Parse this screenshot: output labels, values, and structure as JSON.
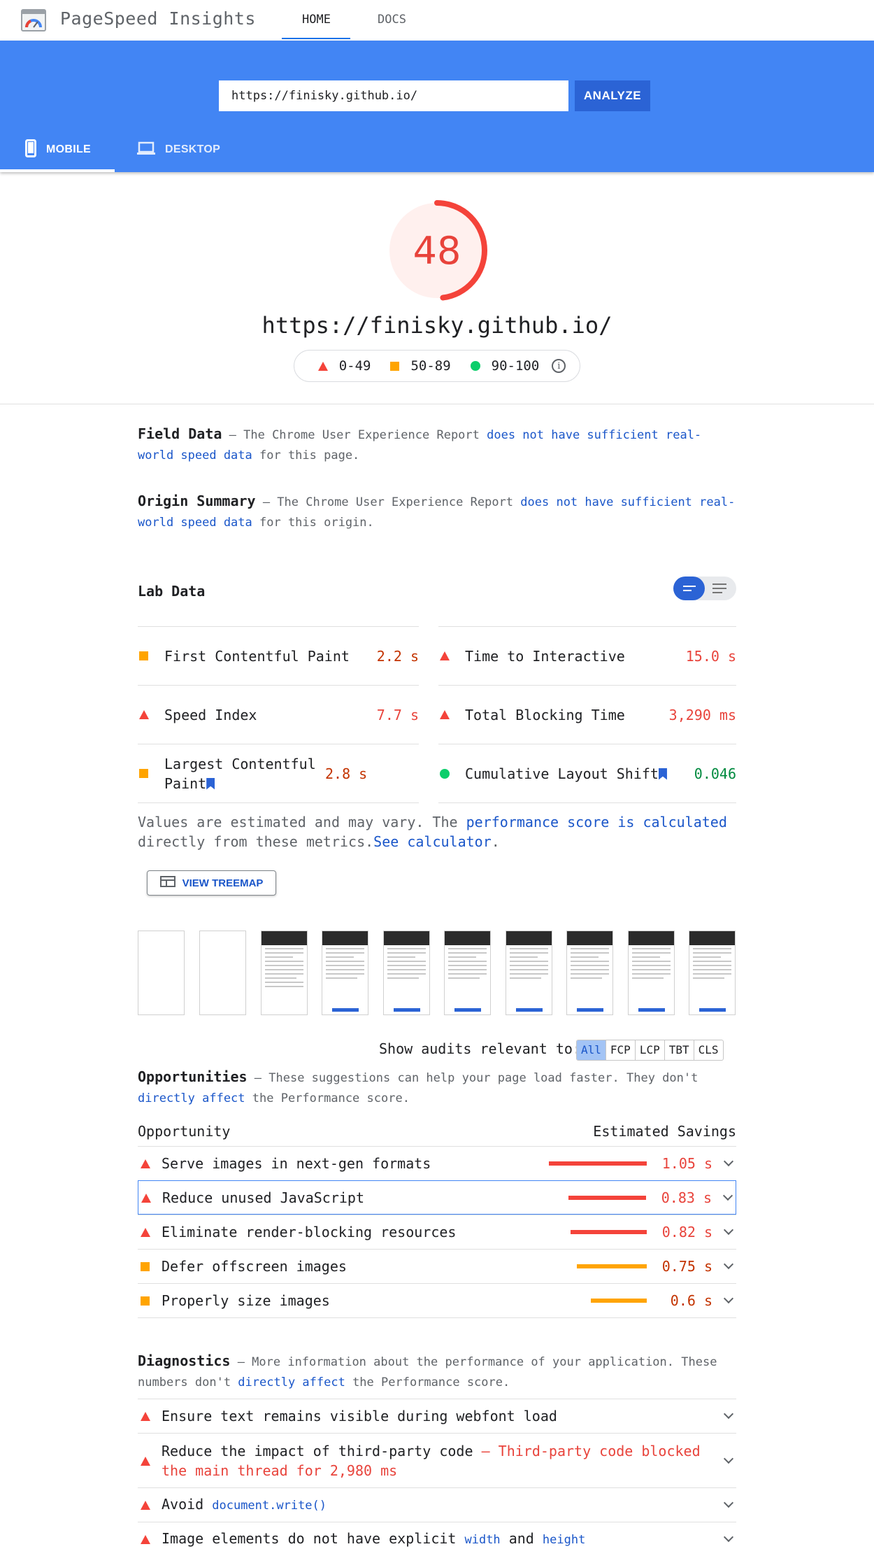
{
  "header": {
    "app_title": "PageSpeed Insights",
    "nav_home": "HOME",
    "nav_docs": "DOCS"
  },
  "search": {
    "url_value": "https://finisky.github.io/",
    "analyze_label": "ANALYZE"
  },
  "device_tabs": {
    "mobile": "MOBILE",
    "desktop": "DESKTOP"
  },
  "score": {
    "value": "48",
    "fraction": 0.48,
    "url": "https://finisky.github.io/",
    "legend": [
      {
        "range": "0-49",
        "type": "fail"
      },
      {
        "range": "50-89",
        "type": "average"
      },
      {
        "range": "90-100",
        "type": "pass"
      }
    ]
  },
  "field_data": {
    "title": "Field Data",
    "pre": " – The Chrome User Experience Report ",
    "link": "does not have sufficient real-world speed data",
    "post": " for this page."
  },
  "origin_summary": {
    "title": "Origin Summary",
    "pre": " – The Chrome User Experience Report ",
    "link": "does not have sufficient real-world speed data",
    "post": " for this origin."
  },
  "lab_data": {
    "title": "Lab Data",
    "metrics": {
      "fcp": {
        "name": "First Contentful Paint",
        "value": "2.2 s"
      },
      "tti": {
        "name": "Time to Interactive",
        "value": "15.0 s"
      },
      "si": {
        "name": "Speed Index",
        "value": "7.7 s"
      },
      "tbt": {
        "name": "Total Blocking Time",
        "value": "3,290 ms"
      },
      "lcp": {
        "name": "Largest Contentful Paint",
        "value": "2.8 s"
      },
      "cls": {
        "name": "Cumulative Layout Shift",
        "value": "0.046"
      }
    },
    "note_pre": "Values are estimated and may vary. The ",
    "note_link": "performance score is calculated",
    "note_mid": " directly from these metrics.",
    "note_link2": "See calculator",
    "note_end": ".",
    "treemap_label": "VIEW TREEMAP"
  },
  "filters": {
    "label": "Show audits relevant to:",
    "options": [
      "All",
      "FCP",
      "LCP",
      "TBT",
      "CLS"
    ]
  },
  "opportunities": {
    "title": "Opportunities",
    "desc_pre": " – These suggestions can help your page load faster. They don't ",
    "desc_link": "directly affect",
    "desc_post": " the Performance score.",
    "col_left": "Opportunity",
    "col_right": "Estimated Savings",
    "items": [
      {
        "name": "Serve images in next-gen formats",
        "savings": "1.05 s",
        "seconds": 1.05,
        "severity": "fail"
      },
      {
        "name": "Reduce unused JavaScript",
        "savings": "0.83 s",
        "seconds": 0.83,
        "severity": "fail"
      },
      {
        "name": "Eliminate render-blocking resources",
        "savings": "0.82 s",
        "seconds": 0.82,
        "severity": "fail"
      },
      {
        "name": "Defer offscreen images",
        "savings": "0.75 s",
        "seconds": 0.75,
        "severity": "average"
      },
      {
        "name": "Properly size images",
        "savings": "0.6 s",
        "seconds": 0.6,
        "severity": "average"
      }
    ]
  },
  "diagnostics": {
    "title": "Diagnostics",
    "desc_pre": " – More information about the performance of your application. These numbers don't ",
    "desc_link": "directly affect",
    "desc_post": " the Performance score.",
    "item1": "Ensure text remains visible during webfont load",
    "item2": "Reduce the impact of third-party code",
    "item2_warn": " – Third-party code blocked the main thread for 2,980 ms",
    "item3_pre": "Avoid ",
    "item3_code": "document.write()",
    "item4_pre": "Image elements do not have explicit ",
    "item4_code1": "width",
    "item4_mid": " and ",
    "item4_code2": "height"
  },
  "colors": {
    "fail": "#f4433a",
    "average": "#ffa400",
    "pass": "#0cce6b",
    "brand_blue": "#4285f4"
  }
}
